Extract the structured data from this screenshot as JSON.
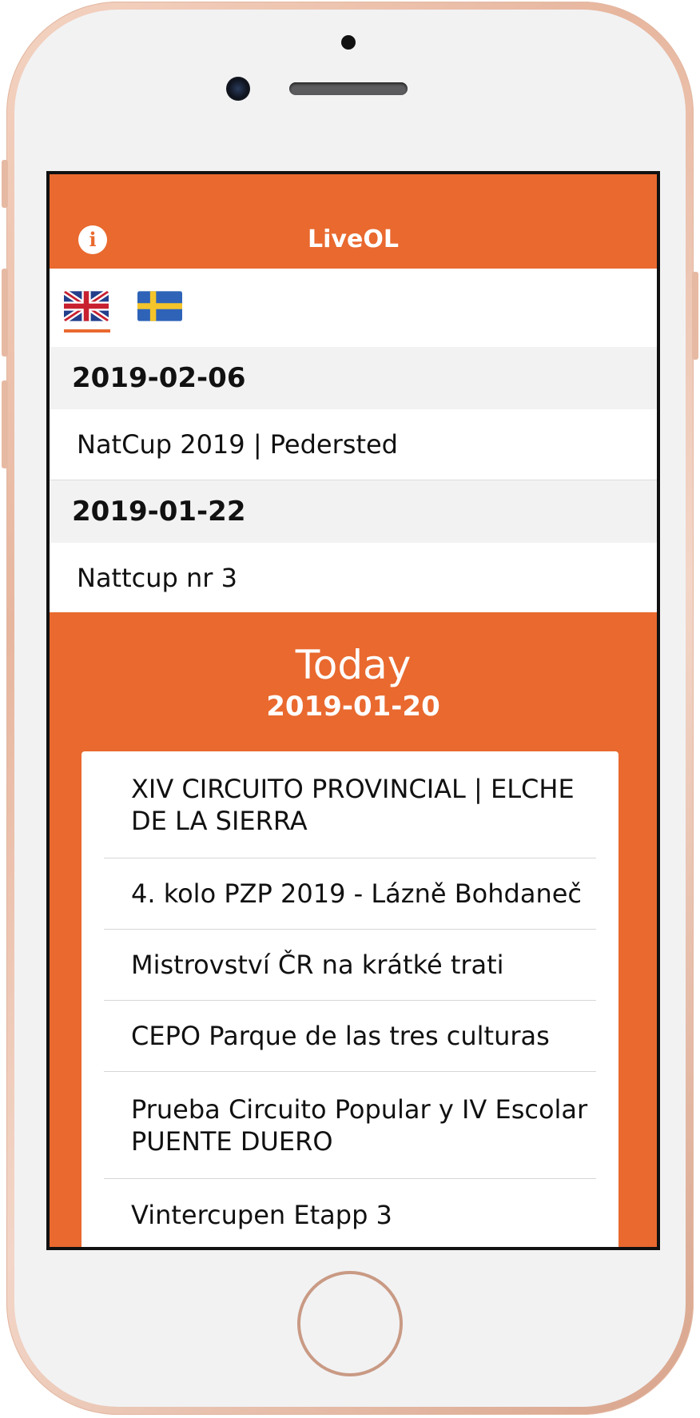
{
  "app": {
    "title": "LiveOL"
  },
  "colors": {
    "accent": "#e9692f",
    "section_bg": "#f2f2f3",
    "text": "#111111"
  },
  "icons": {
    "info": "info-icon",
    "english_flag": "uk-flag-icon",
    "swedish_flag": "sweden-flag-icon"
  },
  "language": {
    "selected": "English",
    "options": [
      "English",
      "Svenska"
    ]
  },
  "sections": [
    {
      "date": "2019-02-06",
      "items": [
        "NatCup 2019 | Pedersted"
      ]
    },
    {
      "date": "2019-01-22",
      "items": [
        "Nattcup nr 3"
      ]
    }
  ],
  "today": {
    "label": "Today",
    "date": "2019-01-20",
    "items": [
      "XIV CIRCUITO PROVINCIAL | ELCHE DE LA SIERRA",
      "4. kolo PZP 2019 - Lázně Bohdaneč",
      "Mistrovství ČR na krátké trati",
      "CEPO Parque de las tres culturas",
      "Prueba Circuito Popular y IV Escolar PUENTE DUERO",
      "Vintercupen Etapp 3"
    ]
  }
}
